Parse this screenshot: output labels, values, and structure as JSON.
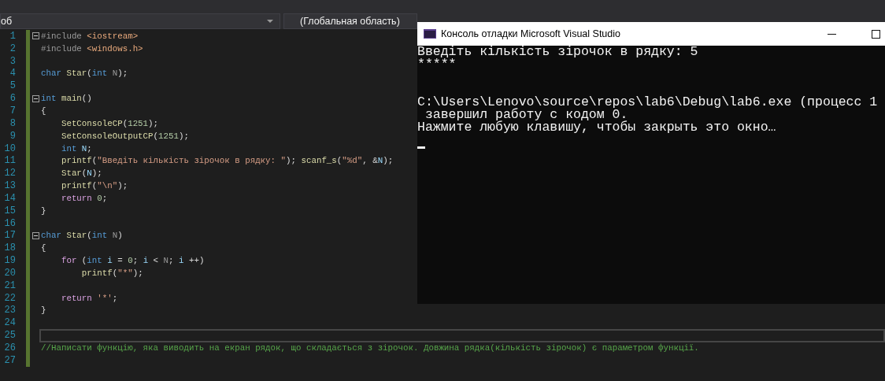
{
  "toolbar": {
    "file_dropdown": "об",
    "scope_dropdown": "(Глобальная область)"
  },
  "editor": {
    "lines": [
      {
        "n": "1",
        "fold": true,
        "current": false,
        "tokens": [
          {
            "kind": "pp",
            "text": "#include "
          },
          {
            "kind": "inc",
            "text": "<iostream>"
          }
        ]
      },
      {
        "n": "2",
        "fold": false,
        "current": false,
        "tokens": [
          {
            "kind": "pp",
            "text": "#include "
          },
          {
            "kind": "inc",
            "text": "<windows.h>"
          }
        ]
      },
      {
        "n": "3",
        "fold": false,
        "current": false
      },
      {
        "n": "4",
        "fold": false,
        "current": false,
        "tokens": [
          {
            "kind": "kw",
            "text": "char "
          },
          {
            "kind": "fn",
            "text": "Star"
          },
          {
            "kind": "plain",
            "text": "("
          },
          {
            "kind": "kw",
            "text": "int "
          },
          {
            "kind": "param",
            "text": "N"
          },
          {
            "kind": "plain",
            "text": ");"
          }
        ]
      },
      {
        "n": "5",
        "fold": false,
        "current": false
      },
      {
        "n": "6",
        "fold": true,
        "current": false,
        "tokens": [
          {
            "kind": "kw",
            "text": "int "
          },
          {
            "kind": "fn",
            "text": "main"
          },
          {
            "kind": "plain",
            "text": "()"
          }
        ]
      },
      {
        "n": "7",
        "fold": false,
        "current": false,
        "tokens": [
          {
            "kind": "plain",
            "text": "{"
          }
        ]
      },
      {
        "n": "8",
        "fold": false,
        "current": false,
        "tokens": [
          {
            "kind": "fn",
            "text": "    SetConsoleCP"
          },
          {
            "kind": "plain",
            "text": "("
          },
          {
            "kind": "num",
            "text": "1251"
          },
          {
            "kind": "plain",
            "text": ");"
          }
        ]
      },
      {
        "n": "9",
        "fold": false,
        "current": false,
        "tokens": [
          {
            "kind": "fn",
            "text": "    SetConsoleOutputCP"
          },
          {
            "kind": "plain",
            "text": "("
          },
          {
            "kind": "num",
            "text": "1251"
          },
          {
            "kind": "plain",
            "text": ");"
          }
        ]
      },
      {
        "n": "10",
        "fold": false,
        "current": false,
        "tokens": [
          {
            "kind": "kw",
            "text": "    int "
          },
          {
            "kind": "var",
            "text": "N"
          },
          {
            "kind": "plain",
            "text": ";"
          }
        ]
      },
      {
        "n": "11",
        "fold": false,
        "current": false,
        "tokens": [
          {
            "kind": "fn",
            "text": "    printf"
          },
          {
            "kind": "plain",
            "text": "("
          },
          {
            "kind": "str",
            "text": "\"Введіть кількість зірочок в рядку: \""
          },
          {
            "kind": "plain",
            "text": "); "
          },
          {
            "kind": "fn",
            "text": "scanf_s"
          },
          {
            "kind": "plain",
            "text": "("
          },
          {
            "kind": "str",
            "text": "\"%d\""
          },
          {
            "kind": "plain",
            "text": ", &"
          },
          {
            "kind": "var",
            "text": "N"
          },
          {
            "kind": "plain",
            "text": ");"
          }
        ]
      },
      {
        "n": "12",
        "fold": false,
        "current": false,
        "tokens": [
          {
            "kind": "fn",
            "text": "    Star"
          },
          {
            "kind": "plain",
            "text": "("
          },
          {
            "kind": "var",
            "text": "N"
          },
          {
            "kind": "plain",
            "text": ");"
          }
        ]
      },
      {
        "n": "13",
        "fold": false,
        "current": false,
        "tokens": [
          {
            "kind": "fn",
            "text": "    printf"
          },
          {
            "kind": "plain",
            "text": "("
          },
          {
            "kind": "str",
            "text": "\"\\n\""
          },
          {
            "kind": "plain",
            "text": ");"
          }
        ]
      },
      {
        "n": "14",
        "fold": false,
        "current": false,
        "tokens": [
          {
            "kind": "ctl",
            "text": "    return "
          },
          {
            "kind": "num",
            "text": "0"
          },
          {
            "kind": "plain",
            "text": ";"
          }
        ]
      },
      {
        "n": "15",
        "fold": false,
        "current": false,
        "tokens": [
          {
            "kind": "plain",
            "text": "}"
          }
        ]
      },
      {
        "n": "16",
        "fold": false,
        "current": false
      },
      {
        "n": "17",
        "fold": true,
        "current": false,
        "tokens": [
          {
            "kind": "kw",
            "text": "char "
          },
          {
            "kind": "fn",
            "text": "Star"
          },
          {
            "kind": "plain",
            "text": "("
          },
          {
            "kind": "kw",
            "text": "int "
          },
          {
            "kind": "param",
            "text": "N"
          },
          {
            "kind": "plain",
            "text": ")"
          }
        ]
      },
      {
        "n": "18",
        "fold": false,
        "current": false,
        "tokens": [
          {
            "kind": "plain",
            "text": "{"
          }
        ]
      },
      {
        "n": "19",
        "fold": false,
        "current": false,
        "tokens": [
          {
            "kind": "ctl",
            "text": "    for "
          },
          {
            "kind": "plain",
            "text": "("
          },
          {
            "kind": "kw",
            "text": "int "
          },
          {
            "kind": "var",
            "text": "i"
          },
          {
            "kind": "plain",
            "text": " = "
          },
          {
            "kind": "num",
            "text": "0"
          },
          {
            "kind": "plain",
            "text": "; "
          },
          {
            "kind": "var",
            "text": "i"
          },
          {
            "kind": "plain",
            "text": " < "
          },
          {
            "kind": "param",
            "text": "N"
          },
          {
            "kind": "plain",
            "text": "; "
          },
          {
            "kind": "var",
            "text": "i"
          },
          {
            "kind": "plain",
            "text": " ++)"
          }
        ]
      },
      {
        "n": "20",
        "fold": false,
        "current": false,
        "tokens": [
          {
            "kind": "fn",
            "text": "        printf"
          },
          {
            "kind": "plain",
            "text": "("
          },
          {
            "kind": "str",
            "text": "\"*\""
          },
          {
            "kind": "plain",
            "text": ");"
          }
        ]
      },
      {
        "n": "21",
        "fold": false,
        "current": false
      },
      {
        "n": "22",
        "fold": false,
        "current": false,
        "tokens": [
          {
            "kind": "ctl",
            "text": "    return "
          },
          {
            "kind": "str",
            "text": "'*'"
          },
          {
            "kind": "plain",
            "text": ";"
          }
        ]
      },
      {
        "n": "23",
        "fold": false,
        "current": false,
        "tokens": [
          {
            "kind": "plain",
            "text": "}"
          }
        ]
      },
      {
        "n": "24",
        "fold": false,
        "current": false
      },
      {
        "n": "25",
        "fold": false,
        "current": true
      },
      {
        "n": "26",
        "fold": false,
        "current": false,
        "tokens": [
          {
            "kind": "comment",
            "text": "//Написати функцію, яка виводить на екран рядок, що складається з зірочок. Довжина рядка(кількість зірочок) є параметром функції."
          }
        ]
      },
      {
        "n": "27",
        "fold": false,
        "current": false
      }
    ]
  },
  "console": {
    "title": "Консоль отладки Microsoft Visual Studio",
    "blocks": [
      [
        "Введіть кількість зірочок в рядку: 5",
        "*****"
      ],
      [
        "C:\\Users\\Lenovo\\source\\repos\\lab6\\Debug\\lab6.exe (процесс 1",
        " завершил работу с кодом 0.",
        "Нажмите любую клавишу, чтобы закрыть это окно…"
      ]
    ]
  }
}
